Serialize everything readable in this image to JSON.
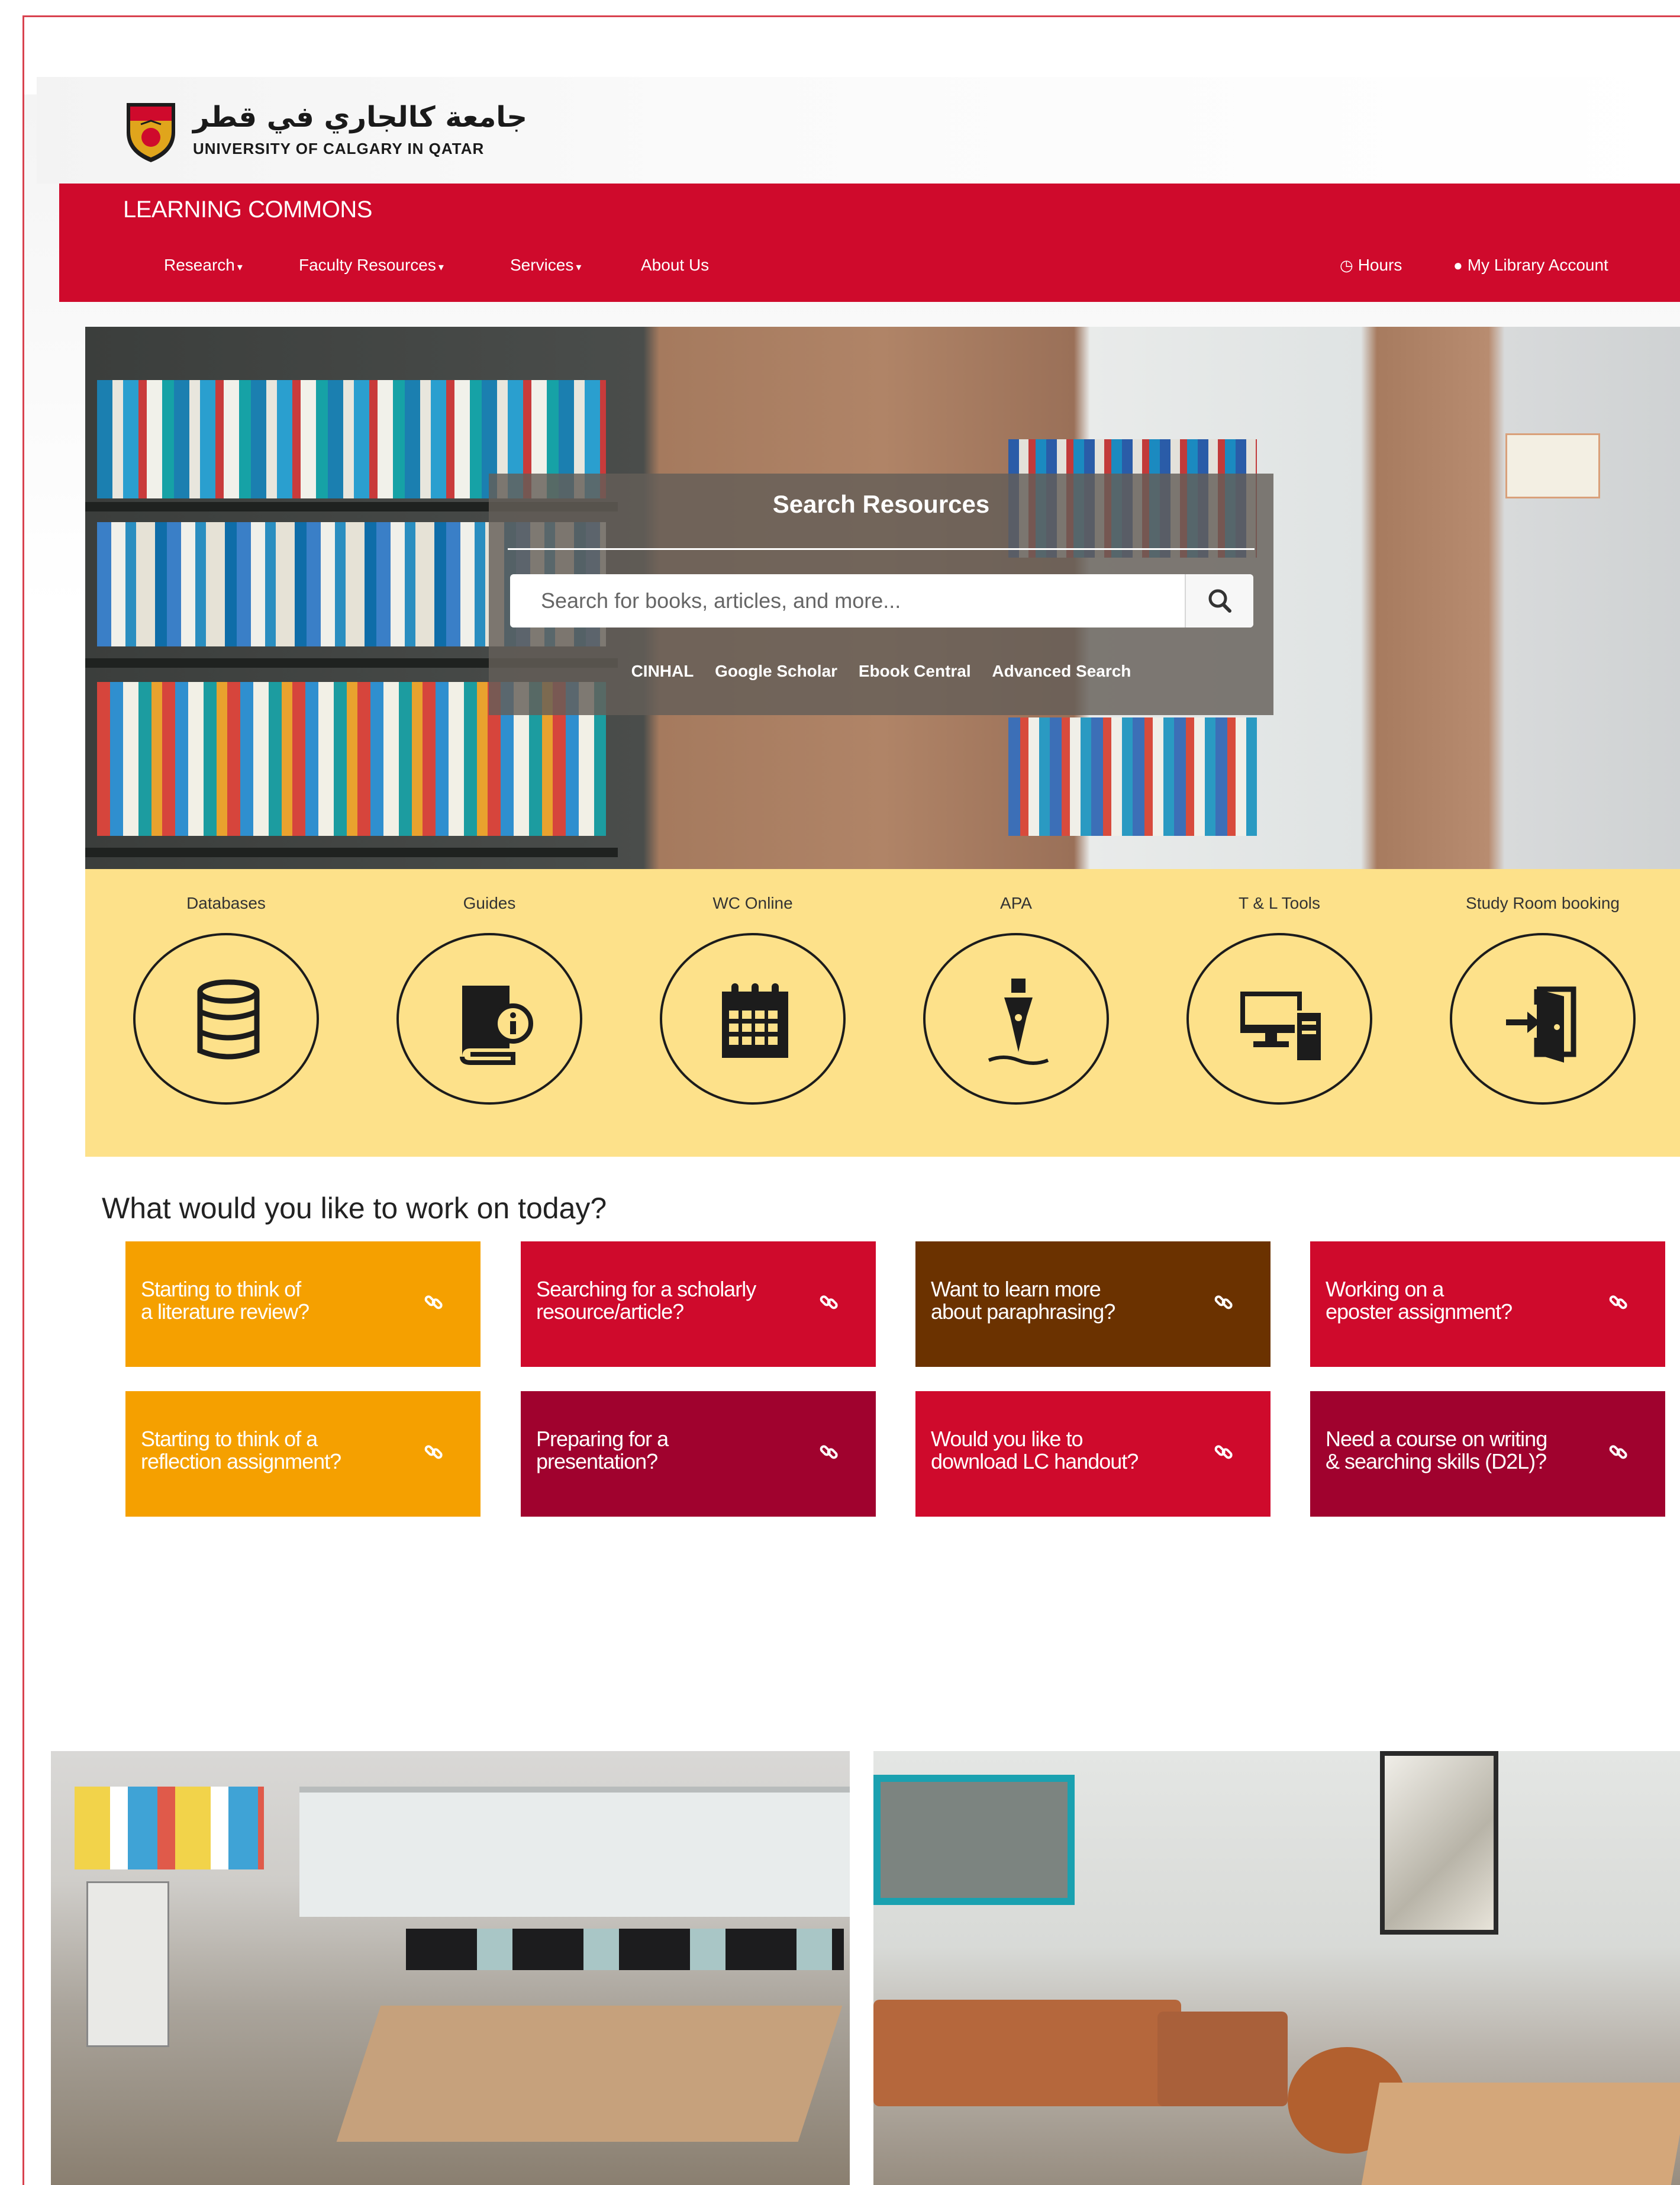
{
  "header": {
    "logo_arabic": "جامعة كالجاري في قطر",
    "logo_english": "UNIVERSITY OF CALGARY IN QATAR",
    "site_title": "LEARNING COMMONS"
  },
  "nav": {
    "items": [
      {
        "label": "Research",
        "caret": "▾"
      },
      {
        "label": "Faculty Resources",
        "caret": "▾"
      },
      {
        "label": "Services",
        "caret": "▾"
      },
      {
        "label": "About Us",
        "caret": ""
      }
    ],
    "hours_label": "Hours",
    "account_label": "My Library Account"
  },
  "search": {
    "title": "Search Resources",
    "placeholder": "Search for books, articles, and more...",
    "links": [
      "CINHAL",
      "Google Scholar",
      "Ebook Central",
      "Advanced Search"
    ]
  },
  "quick_links": [
    {
      "label": "Databases",
      "icon": "database-icon"
    },
    {
      "label": "Guides",
      "icon": "book-info-icon"
    },
    {
      "label": "WC Online",
      "icon": "calendar-icon"
    },
    {
      "label": "APA",
      "icon": "fountain-pen-icon"
    },
    {
      "label": "T & L Tools",
      "icon": "computer-icon"
    },
    {
      "label": "Study Room booking",
      "icon": "door-enter-icon"
    }
  ],
  "work": {
    "heading": "What would you like to work on today?",
    "tiles": [
      {
        "line1": "Starting to think of",
        "line2": "a literature review?",
        "color": "#f5a000"
      },
      {
        "line1": "Searching for a scholarly",
        "line2": "resource/article?",
        "color": "#cf0a2c"
      },
      {
        "line1": "Want to learn more",
        "line2": "about paraphrasing?",
        "color": "#6b3200"
      },
      {
        "line1": "Working on a",
        "line2": "eposter assignment?",
        "color": "#cf0a2c"
      },
      {
        "line1": "Starting to think of a",
        "line2": "reflection assignment?",
        "color": "#f5a000"
      },
      {
        "line1": "Preparing for a",
        "line2": "presentation?",
        "color": "#a0022e"
      },
      {
        "line1": "Would you like to",
        "line2": "download LC handout?",
        "color": "#cf0a2c"
      },
      {
        "line1": "Need a course on writing",
        "line2": "& searching skills (D2L)?",
        "color": "#a0022e"
      }
    ],
    "link_icon": "link-icon"
  },
  "colors": {
    "brand_red": "#cf0a2c",
    "quick_links_bg": "#fde18a"
  }
}
